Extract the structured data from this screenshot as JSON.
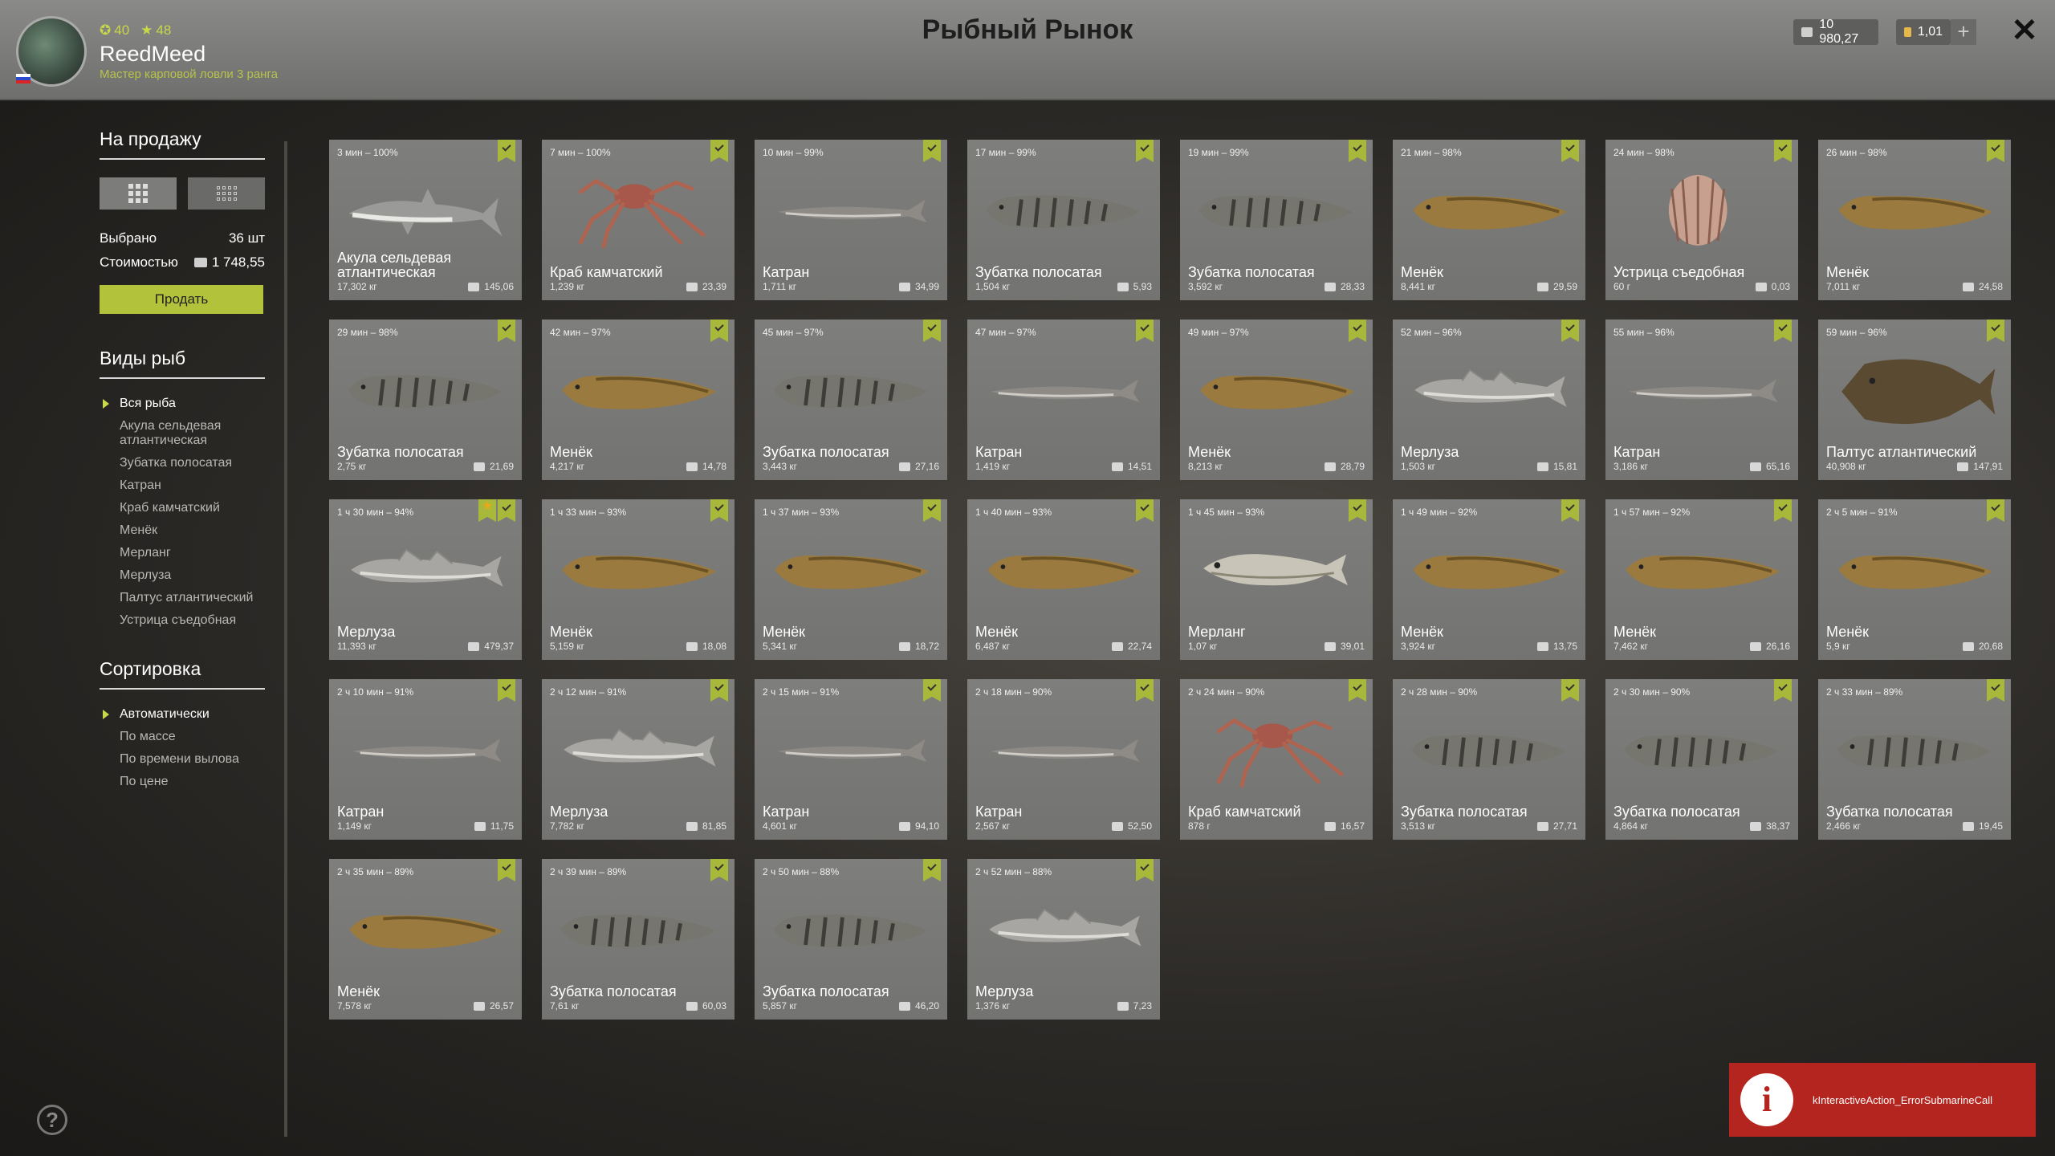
{
  "header": {
    "title": "Рыбный Рынок",
    "username": "ReedMeed",
    "user_title": "Мастер карповой ловли 3 ранга",
    "level": "40",
    "rank": "48",
    "silver": "10 980,27",
    "gold": "1,01",
    "plus": "+",
    "close": "✕"
  },
  "sidebar": {
    "for_sale_title": "На продажу",
    "selected_label": "Выбрано",
    "selected_value": "36 шт",
    "cost_label": "Стоимостью",
    "cost_value": "1 748,55",
    "sell_label": "Продать",
    "species_title": "Виды рыб",
    "species": [
      "Вся рыба",
      "Акула сельдевая атлантическая",
      "Зубатка полосатая",
      "Катран",
      "Краб камчатский",
      "Менёк",
      "Мерланг",
      "Мерлуза",
      "Палтус атлантический",
      "Устрица съедобная"
    ],
    "sort_title": "Сортировка",
    "sort": [
      "Автоматически",
      "По массе",
      "По времени вылова",
      "По цене"
    ]
  },
  "cards": [
    {
      "time": "3 мин – 100%",
      "name": "Акула сельдевая атлантическая",
      "weight": "17,302 кг",
      "price": "145,06",
      "kind": "shark"
    },
    {
      "time": "7 мин – 100%",
      "name": "Краб камчатский",
      "weight": "1,239 кг",
      "price": "23,39",
      "kind": "crab"
    },
    {
      "time": "10 мин – 99%",
      "name": "Катран",
      "weight": "1,711 кг",
      "price": "34,99",
      "kind": "dogfish"
    },
    {
      "time": "17 мин – 99%",
      "name": "Зубатка полосатая",
      "weight": "1,504 кг",
      "price": "5,93",
      "kind": "wolffish"
    },
    {
      "time": "19 мин – 99%",
      "name": "Зубатка полосатая",
      "weight": "3,592 кг",
      "price": "28,33",
      "kind": "wolffish"
    },
    {
      "time": "21 мин – 98%",
      "name": "Менёк",
      "weight": "8,441 кг",
      "price": "29,59",
      "kind": "tusk"
    },
    {
      "time": "24 мин – 98%",
      "name": "Устрица съедобная",
      "weight": "60 г",
      "price": "0,03",
      "kind": "oyster"
    },
    {
      "time": "26 мин – 98%",
      "name": "Менёк",
      "weight": "7,011 кг",
      "price": "24,58",
      "kind": "tusk"
    },
    {
      "time": "29 мин – 98%",
      "name": "Зубатка полосатая",
      "weight": "2,75 кг",
      "price": "21,69",
      "kind": "wolffish"
    },
    {
      "time": "42 мин – 97%",
      "name": "Менёк",
      "weight": "4,217 кг",
      "price": "14,78",
      "kind": "tusk"
    },
    {
      "time": "45 мин – 97%",
      "name": "Зубатка полосатая",
      "weight": "3,443 кг",
      "price": "27,16",
      "kind": "wolffish"
    },
    {
      "time": "47 мин – 97%",
      "name": "Катран",
      "weight": "1,419 кг",
      "price": "14,51",
      "kind": "dogfish"
    },
    {
      "time": "49 мин – 97%",
      "name": "Менёк",
      "weight": "8,213 кг",
      "price": "28,79",
      "kind": "tusk"
    },
    {
      "time": "52 мин – 96%",
      "name": "Мерлуза",
      "weight": "1,503 кг",
      "price": "15,81",
      "kind": "hake"
    },
    {
      "time": "55 мин – 96%",
      "name": "Катран",
      "weight": "3,186 кг",
      "price": "65,16",
      "kind": "dogfish"
    },
    {
      "time": "59 мин – 96%",
      "name": "Палтус атлантический",
      "weight": "40,908 кг",
      "price": "147,91",
      "kind": "halibut"
    },
    {
      "time": "1 ч 30 мин – 94%",
      "name": "Мерлуза",
      "weight": "11,393 кг",
      "price": "479,37",
      "kind": "hake",
      "star": true
    },
    {
      "time": "1 ч 33 мин – 93%",
      "name": "Менёк",
      "weight": "5,159 кг",
      "price": "18,08",
      "kind": "tusk"
    },
    {
      "time": "1 ч 37 мин – 93%",
      "name": "Менёк",
      "weight": "5,341 кг",
      "price": "18,72",
      "kind": "tusk"
    },
    {
      "time": "1 ч 40 мин – 93%",
      "name": "Менёк",
      "weight": "6,487 кг",
      "price": "22,74",
      "kind": "tusk"
    },
    {
      "time": "1 ч 45 мин – 93%",
      "name": "Мерланг",
      "weight": "1,07 кг",
      "price": "39,01",
      "kind": "whiting"
    },
    {
      "time": "1 ч 49 мин – 92%",
      "name": "Менёк",
      "weight": "3,924 кг",
      "price": "13,75",
      "kind": "tusk"
    },
    {
      "time": "1 ч 57 мин – 92%",
      "name": "Менёк",
      "weight": "7,462 кг",
      "price": "26,16",
      "kind": "tusk"
    },
    {
      "time": "2 ч 5 мин – 91%",
      "name": "Менёк",
      "weight": "5,9 кг",
      "price": "20,68",
      "kind": "tusk"
    },
    {
      "time": "2 ч 10 мин – 91%",
      "name": "Катран",
      "weight": "1,149 кг",
      "price": "11,75",
      "kind": "dogfish"
    },
    {
      "time": "2 ч 12 мин – 91%",
      "name": "Мерлуза",
      "weight": "7,782 кг",
      "price": "81,85",
      "kind": "hake"
    },
    {
      "time": "2 ч 15 мин – 91%",
      "name": "Катран",
      "weight": "4,601 кг",
      "price": "94,10",
      "kind": "dogfish"
    },
    {
      "time": "2 ч 18 мин – 90%",
      "name": "Катран",
      "weight": "2,567 кг",
      "price": "52,50",
      "kind": "dogfish"
    },
    {
      "time": "2 ч 24 мин – 90%",
      "name": "Краб камчатский",
      "weight": "878 г",
      "price": "16,57",
      "kind": "crab"
    },
    {
      "time": "2 ч 28 мин – 90%",
      "name": "Зубатка полосатая",
      "weight": "3,513 кг",
      "price": "27,71",
      "kind": "wolffish"
    },
    {
      "time": "2 ч 30 мин – 90%",
      "name": "Зубатка полосатая",
      "weight": "4,864 кг",
      "price": "38,37",
      "kind": "wolffish"
    },
    {
      "time": "2 ч 33 мин – 89%",
      "name": "Зубатка полосатая",
      "weight": "2,466 кг",
      "price": "19,45",
      "kind": "wolffish"
    },
    {
      "time": "2 ч 35 мин – 89%",
      "name": "Менёк",
      "weight": "7,578 кг",
      "price": "26,57",
      "kind": "tusk"
    },
    {
      "time": "2 ч 39 мин – 89%",
      "name": "Зубатка полосатая",
      "weight": "7,61 кг",
      "price": "60,03",
      "kind": "wolffish"
    },
    {
      "time": "2 ч 50 мин – 88%",
      "name": "Зубатка полосатая",
      "weight": "5,857 кг",
      "price": "46,20",
      "kind": "wolffish"
    },
    {
      "time": "2 ч 52 мин – 88%",
      "name": "Мерлуза",
      "weight": "1,376 кг",
      "price": "7,23",
      "kind": "hake"
    }
  ],
  "notification": {
    "icon": "i",
    "text": "kInteractiveAction_ErrorSubmarineCall"
  },
  "help": "?",
  "icons": {
    "check": "check-icon",
    "star": "star-icon",
    "coin": "coin-icon"
  },
  "colors": {
    "accent": "#b2c23a",
    "check": "#a8b83a",
    "error": "#b5251f",
    "card": "#7a7a78"
  }
}
